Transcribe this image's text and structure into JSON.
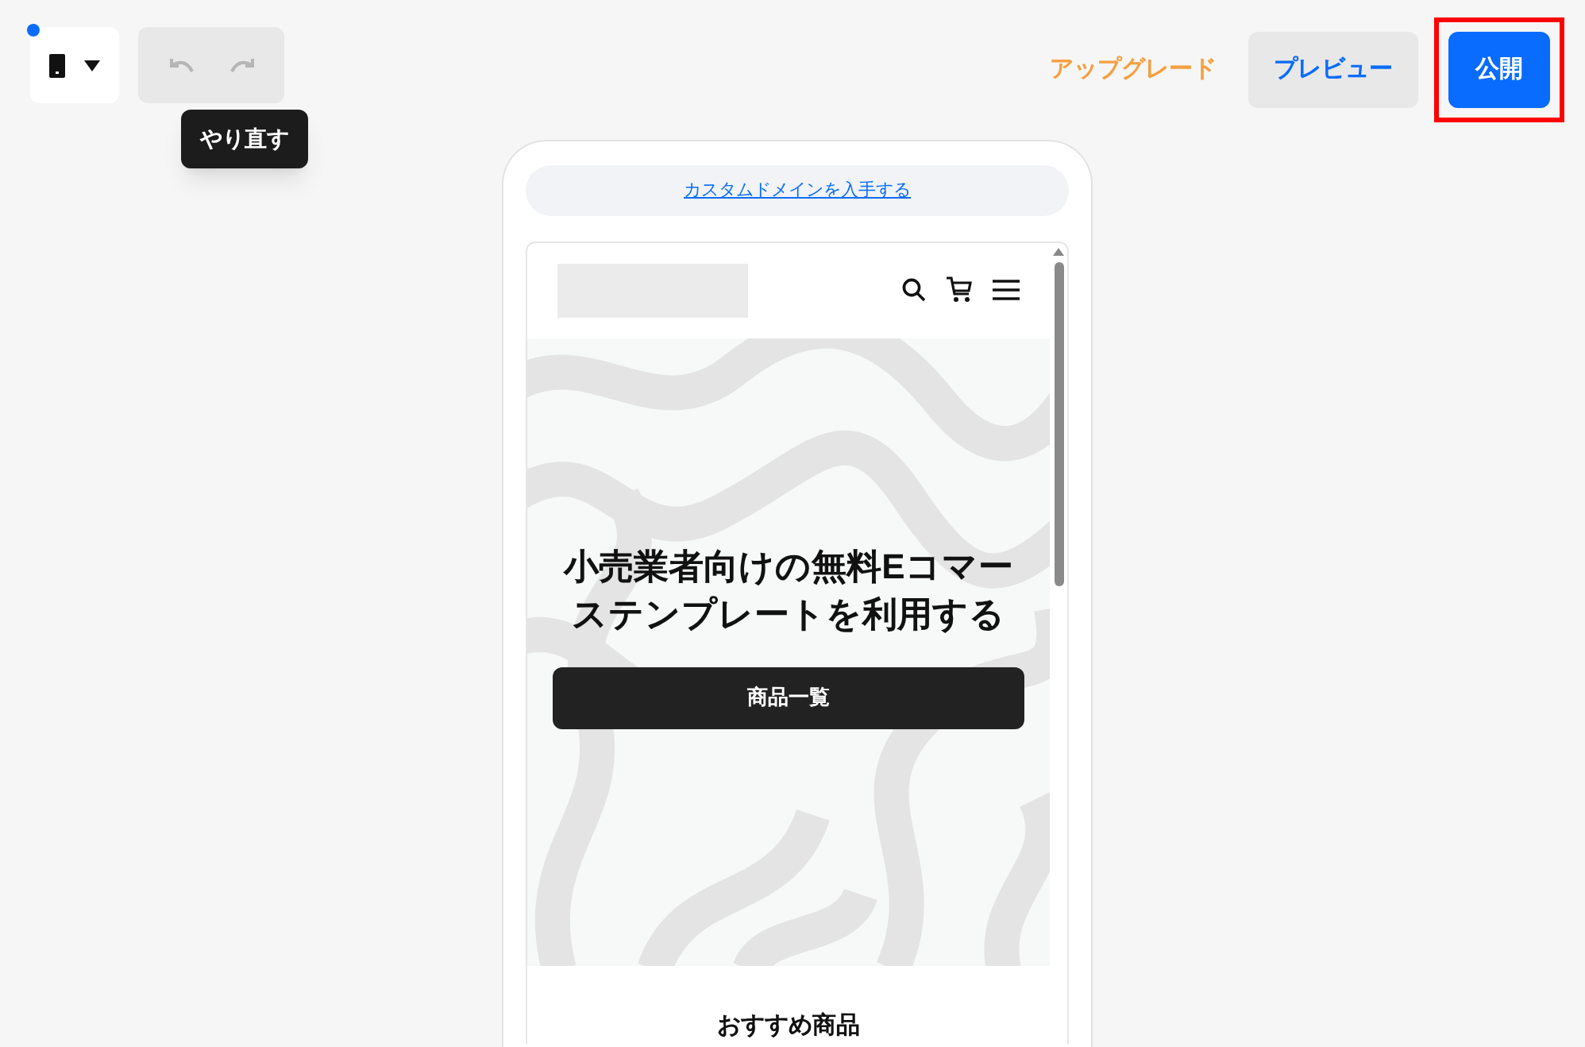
{
  "toolbar": {
    "device_selector": {
      "unsaved_dot": true
    },
    "undo": {
      "disabled": true
    },
    "redo": {
      "disabled": true
    },
    "tooltip": "やり直す",
    "upgrade": "アップグレード",
    "preview": "プレビュー",
    "publish": {
      "label": "公開",
      "highlighted": true
    }
  },
  "phone": {
    "domain_link": "カスタムドメインを入手する",
    "hero": {
      "title": "小売業者向けの無料Eコマーステンプレートを利用する",
      "button": "商品一覧"
    },
    "section_title": "おすすめ商品"
  }
}
